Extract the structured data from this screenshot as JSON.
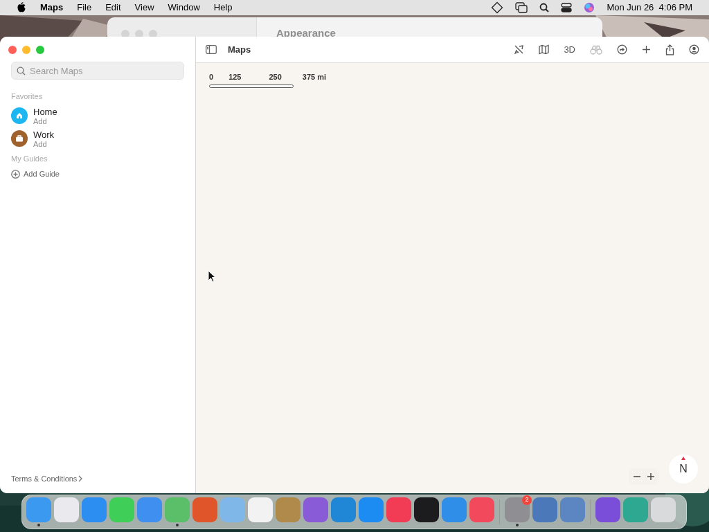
{
  "menu_bar": {
    "app": "Maps",
    "menus": [
      "File",
      "Edit",
      "View",
      "Window",
      "Help"
    ],
    "clock": "Mon Jun 26  4:06 PM"
  },
  "background_window": {
    "title": "Appearance"
  },
  "window": {
    "title": "Maps",
    "search": {
      "placeholder": "Search Maps"
    },
    "favorites": {
      "heading": "Favorites",
      "items": [
        {
          "kind": "home",
          "title": "Home",
          "subtitle": "Add",
          "color": "#1cb6f0"
        },
        {
          "kind": "work",
          "title": "Work",
          "subtitle": "Add",
          "color": "#a0622d"
        }
      ]
    },
    "guides": {
      "heading": "My Guides",
      "add": "Add Guide"
    },
    "terms": "Terms & Conditions",
    "toolbar": {
      "three_d": "3D"
    },
    "scale": [
      "0",
      "125",
      "250",
      "375 mi"
    ],
    "compass": "N"
  },
  "dock": {
    "apps": [
      {
        "color": "#3b9af0",
        "running": true
      },
      {
        "color": "#e9e9ee",
        "running": false
      },
      {
        "color": "#2c8ef0",
        "running": false
      },
      {
        "color": "#3fcf58",
        "running": false
      },
      {
        "color": "#3f8ff0",
        "running": false
      },
      {
        "color": "#5bbf6a",
        "running": true
      },
      {
        "color": "#e0562a",
        "running": false
      },
      {
        "color": "#7fb8e8",
        "running": false
      },
      {
        "color": "#f2f2f2",
        "running": false
      },
      {
        "color": "#b08a4a",
        "running": false
      },
      {
        "color": "#8a5bd6",
        "running": false
      },
      {
        "color": "#1f87d6",
        "running": false
      },
      {
        "color": "#1d8cf2",
        "running": false
      },
      {
        "color": "#f23b55",
        "running": false
      },
      {
        "color": "#1c1c1e",
        "running": false
      },
      {
        "color": "#2f8ee8",
        "running": false
      },
      {
        "color": "#f24a5c",
        "running": false
      },
      {
        "color": "#8e8e93",
        "running": true,
        "badge": "2"
      },
      {
        "color": "#4a78b8",
        "running": false
      },
      {
        "color": "#5b86c2",
        "running": false
      },
      {
        "color": "#7a4ed8",
        "running": false
      },
      {
        "color": "#2fa892",
        "running": false
      },
      {
        "color": "#d8dadc",
        "running": false
      }
    ]
  }
}
